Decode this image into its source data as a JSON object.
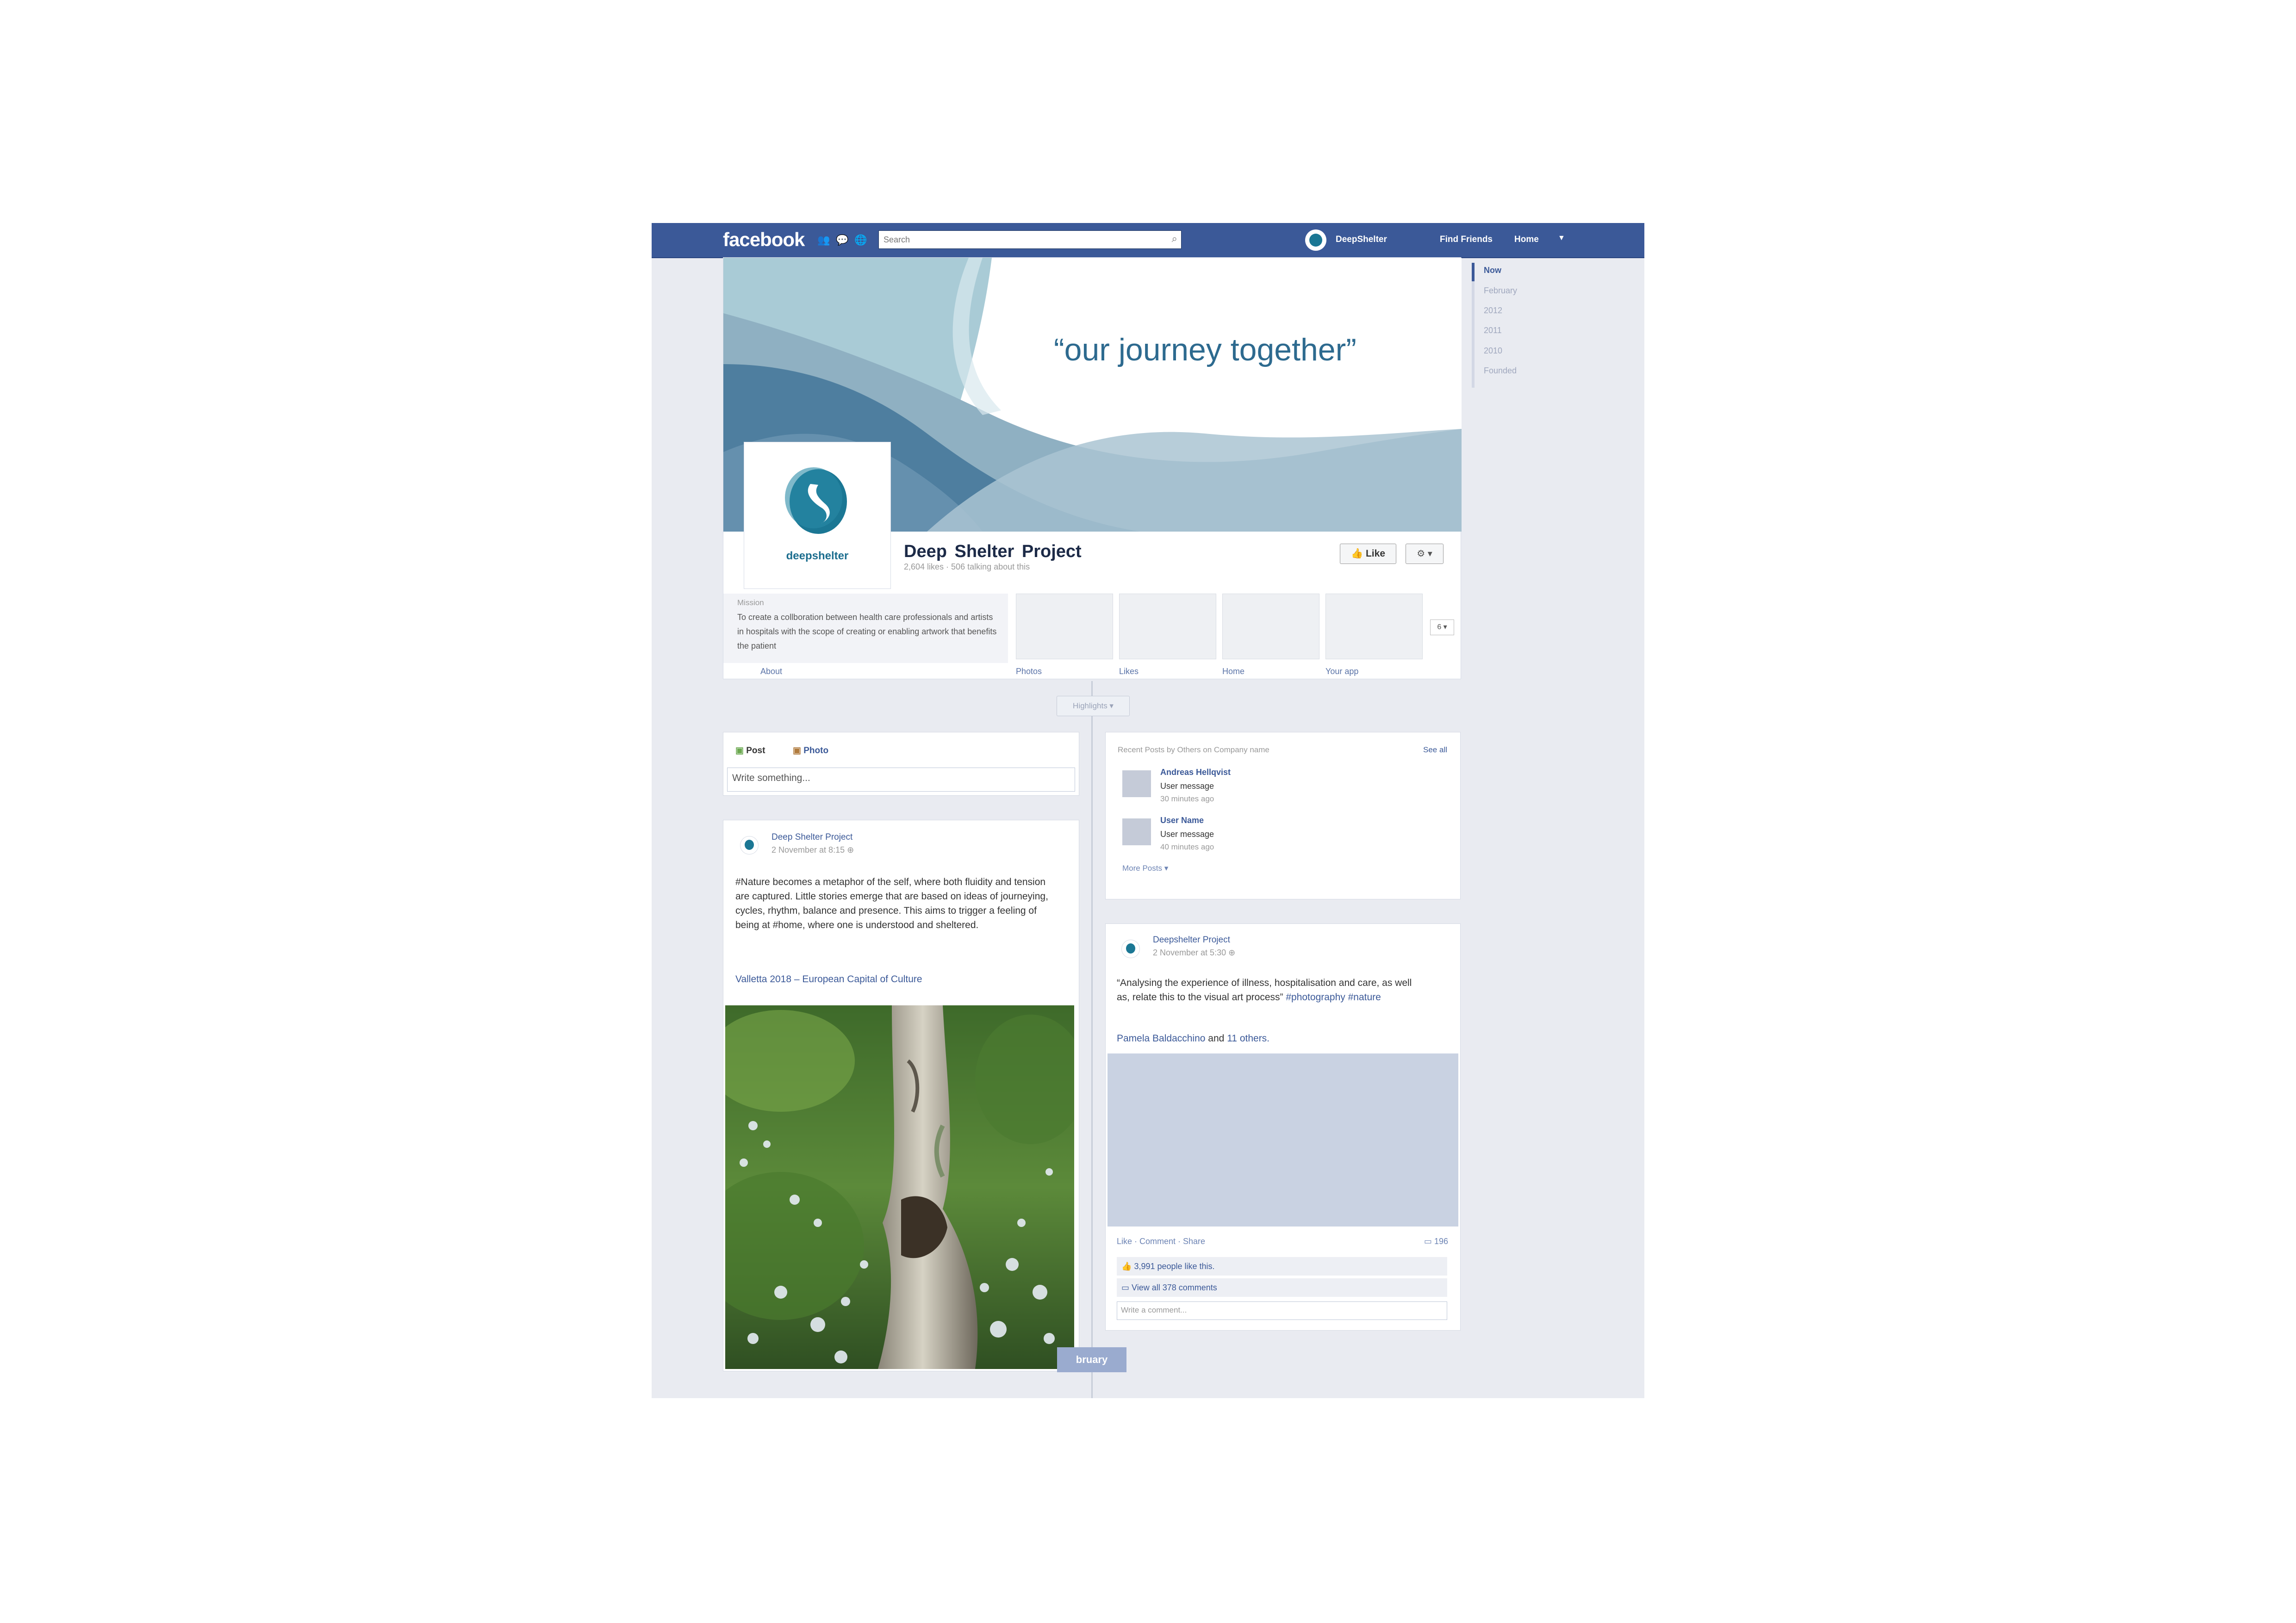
{
  "topbar": {
    "logo": "facebook",
    "search_placeholder": "Search",
    "user_name": "DeepShelter",
    "find_friends": "Find Friends",
    "home": "Home",
    "bar_color": "#3b5998"
  },
  "cover": {
    "quote": "“our journey together”",
    "profile_brand": "deepshelter",
    "page_name": "Deep  Shelter Project",
    "page_meta": "2,604 likes · 506 talking about this",
    "like_label": "Like",
    "gear_label": "⚙ ▾"
  },
  "about": {
    "heading": "Mission",
    "text": "To create a collboration between health care professionals and artists in hospitals with the scope of creating or enabling artwork that benefits the patient",
    "label": "About"
  },
  "tabs": [
    {
      "label": "Photos"
    },
    {
      "label": "Likes"
    },
    {
      "label": "Home"
    },
    {
      "label": "Your app"
    }
  ],
  "tabs_more": "6 ▾",
  "timeline_nav": [
    "Now",
    "February",
    "2012",
    "2011",
    "2010",
    "Founded"
  ],
  "highlights": "Highlights ▾",
  "composer": {
    "post_tab": "Post",
    "photo_tab": "Photo",
    "placeholder": "Write something..."
  },
  "recent": {
    "heading": "Recent Posts by Others on Company name",
    "see_all": "See all",
    "items": [
      {
        "name": "Andreas Hellqvist",
        "message": "User message",
        "time": "30 minutes ago"
      },
      {
        "name": "User Name",
        "message": "User message",
        "time": "40 minutes ago"
      }
    ],
    "more": "More Posts ▾"
  },
  "post1": {
    "author": "Deep  Shelter Project",
    "date": "2 November at 8:15 ⊕",
    "text": "#Nature becomes a metaphor of the self, where both fluidity and tension are captured.  Little stories emerge that are based on ideas of journeying, cycles, rhythm, balance and presence. This aims to trigger a feeling of being at #home, where one is understood and sheltered.",
    "link": "Valletta 2018 – European Capital of Culture"
  },
  "post2": {
    "author": "Deepshelter Project",
    "date": "2 November at 5:30 ⊕",
    "text_main": "“Analysing the experience of illness, hospitalisation and care, as well as, relate this to the visual art process”",
    "hashtags": "#photography #nature",
    "liker": "Pamela Baldacchino",
    "and": "and",
    "others": "11 others.",
    "actions": "Like · Comment · Share",
    "comment_count": "196",
    "likes": "3,991 people like this.",
    "view_comments": "View all 378 comments",
    "comment_placeholder": "Write a comment..."
  },
  "feb_pill": "bruary"
}
